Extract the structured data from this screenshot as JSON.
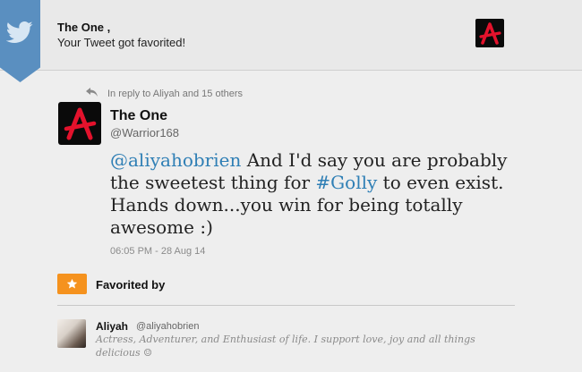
{
  "notification": {
    "title": "The One ,",
    "message": "Your Tweet got favorited!"
  },
  "tweet": {
    "reply_text": "In reply to Aliyah and 15 others",
    "author_name": "The One",
    "author_handle": "@Warrior168",
    "mention": "@aliyahobrien",
    "text_part1": " And I'd say you are probably the sweetest thing for ",
    "hashtag": "#Golly",
    "text_part2": " to even exist. Hands down...you win for being totally awesome :)",
    "timestamp": "06:05 PM - 28 Aug 14"
  },
  "favorited": {
    "label": "Favorited by",
    "user": {
      "name": "Aliyah",
      "handle": "@aliyahobrien",
      "bio": "Actress, Adventurer, and Enthusiast of life. I support love, joy and all things delicious ☺"
    }
  },
  "colors": {
    "brand_blue": "#5a8fc0",
    "link": "#2f7fb5",
    "favorite_orange": "#f5921e",
    "avatar_red": "#e3122c"
  },
  "icons": {
    "brand": "twitter-bird-icon",
    "reply": "reply-arrow-icon",
    "favorite": "star-icon"
  }
}
